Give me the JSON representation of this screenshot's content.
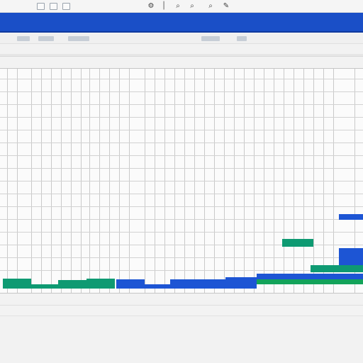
{
  "toolbar": {
    "icons": [
      "square-button-icon",
      "square-button-icon",
      "square-button-icon",
      "settings-icon",
      "cursor-icon",
      "search-icon",
      "search-icon",
      "search-icon",
      "pen-icon"
    ]
  },
  "title_band": {
    "left_label": "",
    "center_label": "",
    "right_label": ""
  },
  "status_bar": {
    "text": ""
  },
  "colors": {
    "title_band": "#1a4fc7",
    "task_blue": "#1d55d4",
    "task_green": "#0e9a72",
    "task_green_alt": "#13a35a",
    "grid_line": "#c9c9c9"
  }
}
